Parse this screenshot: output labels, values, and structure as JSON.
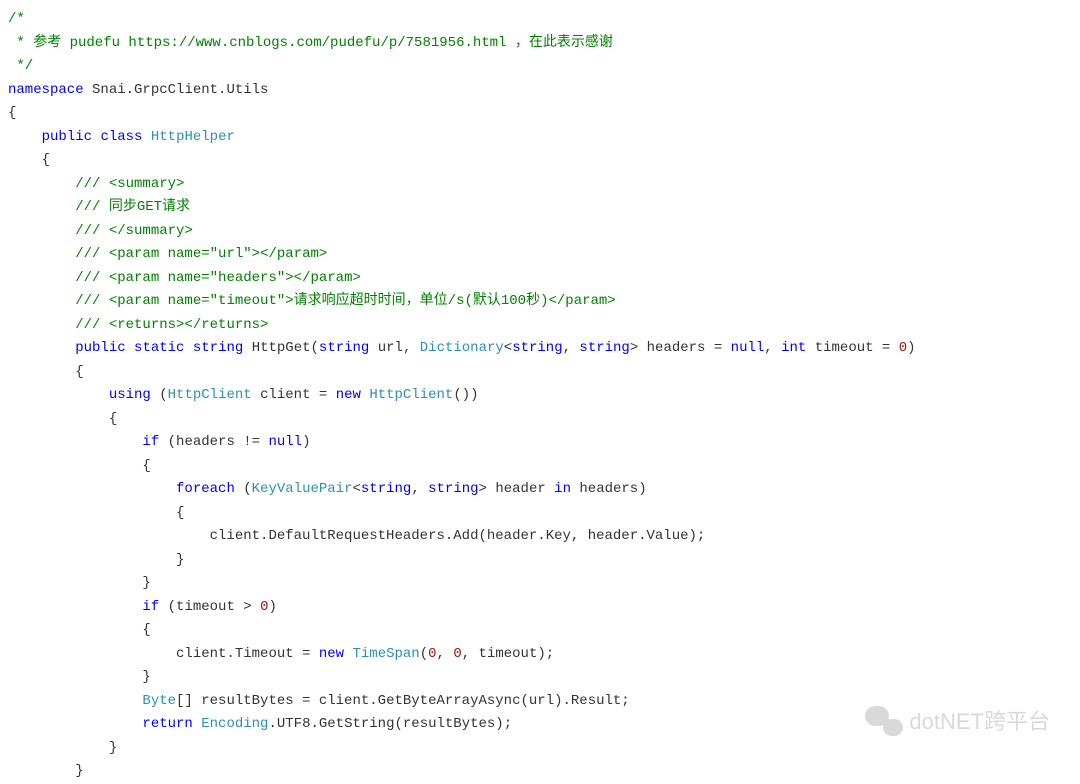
{
  "watermark": {
    "text": "dotNET跨平台"
  },
  "code": {
    "lines": [
      [
        {
          "t": "/*",
          "c": "cm"
        }
      ],
      [
        {
          "t": " * 参考 pudefu https://www.cnblogs.com/pudefu/p/7581956.html ，在此表示感谢",
          "c": "cm"
        }
      ],
      [
        {
          "t": " */",
          "c": "cm"
        }
      ],
      [
        {
          "t": "namespace",
          "c": "kw"
        },
        {
          "t": " Snai.GrpcClient.Utils",
          "c": "pln"
        }
      ],
      [
        {
          "t": "{",
          "c": "pln"
        }
      ],
      [
        {
          "t": "    ",
          "c": "pln"
        },
        {
          "t": "public",
          "c": "kw"
        },
        {
          "t": " ",
          "c": "pln"
        },
        {
          "t": "class",
          "c": "kw"
        },
        {
          "t": " ",
          "c": "pln"
        },
        {
          "t": "HttpHelper",
          "c": "typ"
        }
      ],
      [
        {
          "t": "    {",
          "c": "pln"
        }
      ],
      [
        {
          "t": "        ",
          "c": "pln"
        },
        {
          "t": "/// <summary>",
          "c": "cm"
        }
      ],
      [
        {
          "t": "        ",
          "c": "pln"
        },
        {
          "t": "/// 同步",
          "c": "cm"
        },
        {
          "t": "GET",
          "c": "cm"
        },
        {
          "t": "请求",
          "c": "cm"
        }
      ],
      [
        {
          "t": "        ",
          "c": "pln"
        },
        {
          "t": "/// </summary>",
          "c": "cm"
        }
      ],
      [
        {
          "t": "        ",
          "c": "pln"
        },
        {
          "t": "/// <param name=\"",
          "c": "cm"
        },
        {
          "t": "url",
          "c": "cm"
        },
        {
          "t": "\"></param>",
          "c": "cm"
        }
      ],
      [
        {
          "t": "        ",
          "c": "pln"
        },
        {
          "t": "/// <param name=\"",
          "c": "cm"
        },
        {
          "t": "headers",
          "c": "cm"
        },
        {
          "t": "\"></param>",
          "c": "cm"
        }
      ],
      [
        {
          "t": "        ",
          "c": "pln"
        },
        {
          "t": "/// <param name=\"",
          "c": "cm"
        },
        {
          "t": "timeout",
          "c": "cm"
        },
        {
          "t": "\">请求响应超时时间，单位/s(默认",
          "c": "cm"
        },
        {
          "t": "100",
          "c": "cm"
        },
        {
          "t": "秒)</param>",
          "c": "cm"
        }
      ],
      [
        {
          "t": "        ",
          "c": "pln"
        },
        {
          "t": "/// <returns></returns>",
          "c": "cm"
        }
      ],
      [
        {
          "t": "        ",
          "c": "pln"
        },
        {
          "t": "public",
          "c": "kw"
        },
        {
          "t": " ",
          "c": "pln"
        },
        {
          "t": "static",
          "c": "kw"
        },
        {
          "t": " ",
          "c": "pln"
        },
        {
          "t": "string",
          "c": "kw"
        },
        {
          "t": " HttpGet(",
          "c": "pln"
        },
        {
          "t": "string",
          "c": "kw"
        },
        {
          "t": " url, ",
          "c": "pln"
        },
        {
          "t": "Dictionary",
          "c": "typ"
        },
        {
          "t": "<",
          "c": "pln"
        },
        {
          "t": "string",
          "c": "kw"
        },
        {
          "t": ", ",
          "c": "pln"
        },
        {
          "t": "string",
          "c": "kw"
        },
        {
          "t": "> headers = ",
          "c": "pln"
        },
        {
          "t": "null",
          "c": "kw"
        },
        {
          "t": ", ",
          "c": "pln"
        },
        {
          "t": "int",
          "c": "kw"
        },
        {
          "t": " timeout = ",
          "c": "pln"
        },
        {
          "t": "0",
          "c": "num"
        },
        {
          "t": ")",
          "c": "pln"
        }
      ],
      [
        {
          "t": "        {",
          "c": "pln"
        }
      ],
      [
        {
          "t": "            ",
          "c": "pln"
        },
        {
          "t": "using",
          "c": "kw"
        },
        {
          "t": " (",
          "c": "pln"
        },
        {
          "t": "HttpClient",
          "c": "typ"
        },
        {
          "t": " client = ",
          "c": "pln"
        },
        {
          "t": "new",
          "c": "kw"
        },
        {
          "t": " ",
          "c": "pln"
        },
        {
          "t": "HttpClient",
          "c": "typ"
        },
        {
          "t": "())",
          "c": "pln"
        }
      ],
      [
        {
          "t": "            {",
          "c": "pln"
        }
      ],
      [
        {
          "t": "                ",
          "c": "pln"
        },
        {
          "t": "if",
          "c": "kw"
        },
        {
          "t": " (headers != ",
          "c": "pln"
        },
        {
          "t": "null",
          "c": "kw"
        },
        {
          "t": ")",
          "c": "pln"
        }
      ],
      [
        {
          "t": "                {",
          "c": "pln"
        }
      ],
      [
        {
          "t": "                    ",
          "c": "pln"
        },
        {
          "t": "foreach",
          "c": "kw"
        },
        {
          "t": " (",
          "c": "pln"
        },
        {
          "t": "KeyValuePair",
          "c": "typ"
        },
        {
          "t": "<",
          "c": "pln"
        },
        {
          "t": "string",
          "c": "kw"
        },
        {
          "t": ", ",
          "c": "pln"
        },
        {
          "t": "string",
          "c": "kw"
        },
        {
          "t": "> header ",
          "c": "pln"
        },
        {
          "t": "in",
          "c": "kw"
        },
        {
          "t": " headers)",
          "c": "pln"
        }
      ],
      [
        {
          "t": "                    {",
          "c": "pln"
        }
      ],
      [
        {
          "t": "                        client.DefaultRequestHeaders.Add(header.Key, header.Value);",
          "c": "pln"
        }
      ],
      [
        {
          "t": "                    }",
          "c": "pln"
        }
      ],
      [
        {
          "t": "                }",
          "c": "pln"
        }
      ],
      [
        {
          "t": "                ",
          "c": "pln"
        },
        {
          "t": "if",
          "c": "kw"
        },
        {
          "t": " (timeout > ",
          "c": "pln"
        },
        {
          "t": "0",
          "c": "num"
        },
        {
          "t": ")",
          "c": "pln"
        }
      ],
      [
        {
          "t": "                {",
          "c": "pln"
        }
      ],
      [
        {
          "t": "                    client.Timeout = ",
          "c": "pln"
        },
        {
          "t": "new",
          "c": "kw"
        },
        {
          "t": " ",
          "c": "pln"
        },
        {
          "t": "TimeSpan",
          "c": "typ"
        },
        {
          "t": "(",
          "c": "pln"
        },
        {
          "t": "0",
          "c": "num"
        },
        {
          "t": ", ",
          "c": "pln"
        },
        {
          "t": "0",
          "c": "num"
        },
        {
          "t": ", timeout);",
          "c": "pln"
        }
      ],
      [
        {
          "t": "                }",
          "c": "pln"
        }
      ],
      [
        {
          "t": "                ",
          "c": "pln"
        },
        {
          "t": "Byte",
          "c": "typ"
        },
        {
          "t": "[] resultBytes = client.GetByteArrayAsync(url).Result;",
          "c": "pln"
        }
      ],
      [
        {
          "t": "                ",
          "c": "pln"
        },
        {
          "t": "return",
          "c": "kw"
        },
        {
          "t": " ",
          "c": "pln"
        },
        {
          "t": "Encoding",
          "c": "typ"
        },
        {
          "t": ".UTF8.GetString(resultBytes);",
          "c": "pln"
        }
      ],
      [
        {
          "t": "            }",
          "c": "pln"
        }
      ],
      [
        {
          "t": "        }",
          "c": "pln"
        }
      ]
    ]
  }
}
